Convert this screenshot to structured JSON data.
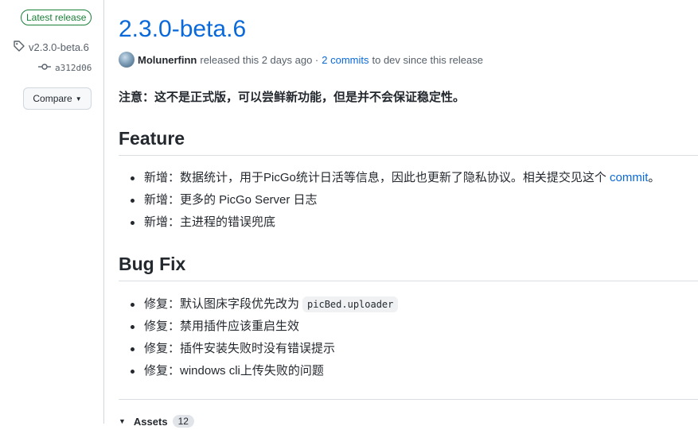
{
  "sidebar": {
    "badge": "Latest release",
    "tag": "v2.3.0-beta.6",
    "commit": "a312d06",
    "compare_label": "Compare"
  },
  "release": {
    "title": "2.3.0-beta.6",
    "author": "Molunerfinn",
    "released_text": "released this 2 days ago ·",
    "commits_link": "2 commits",
    "since_text": "to dev since this release",
    "note": "注意：这不是正式版，可以尝鲜新功能，但是并不会保证稳定性。"
  },
  "feature": {
    "heading": "Feature",
    "items": [
      {
        "text": "新增：数据统计，用于PicGo统计日活等信息，因此也更新了隐私协议。相关提交见这个 ",
        "link": "commit",
        "suffix": "。"
      },
      {
        "text": "新增：更多的 PicGo Server 日志"
      },
      {
        "text": "新增：主进程的错误兜底"
      }
    ]
  },
  "bugfix": {
    "heading": "Bug Fix",
    "items": [
      {
        "text": "修复：默认图床字段优先改为",
        "code": "picBed.uploader"
      },
      {
        "text": "修复：禁用插件应该重启生效"
      },
      {
        "text": "修复：插件安装失败时没有错误提示"
      },
      {
        "text": "修复：windows cli上传失败的问题"
      }
    ]
  },
  "assets": {
    "label": "Assets",
    "count": "12"
  },
  "icons": {
    "tag": "tag-icon",
    "commit": "git-commit-icon",
    "caret": "triangle-down-icon"
  },
  "colors": {
    "link": "#0969da",
    "badge_green": "#1a7f37"
  }
}
